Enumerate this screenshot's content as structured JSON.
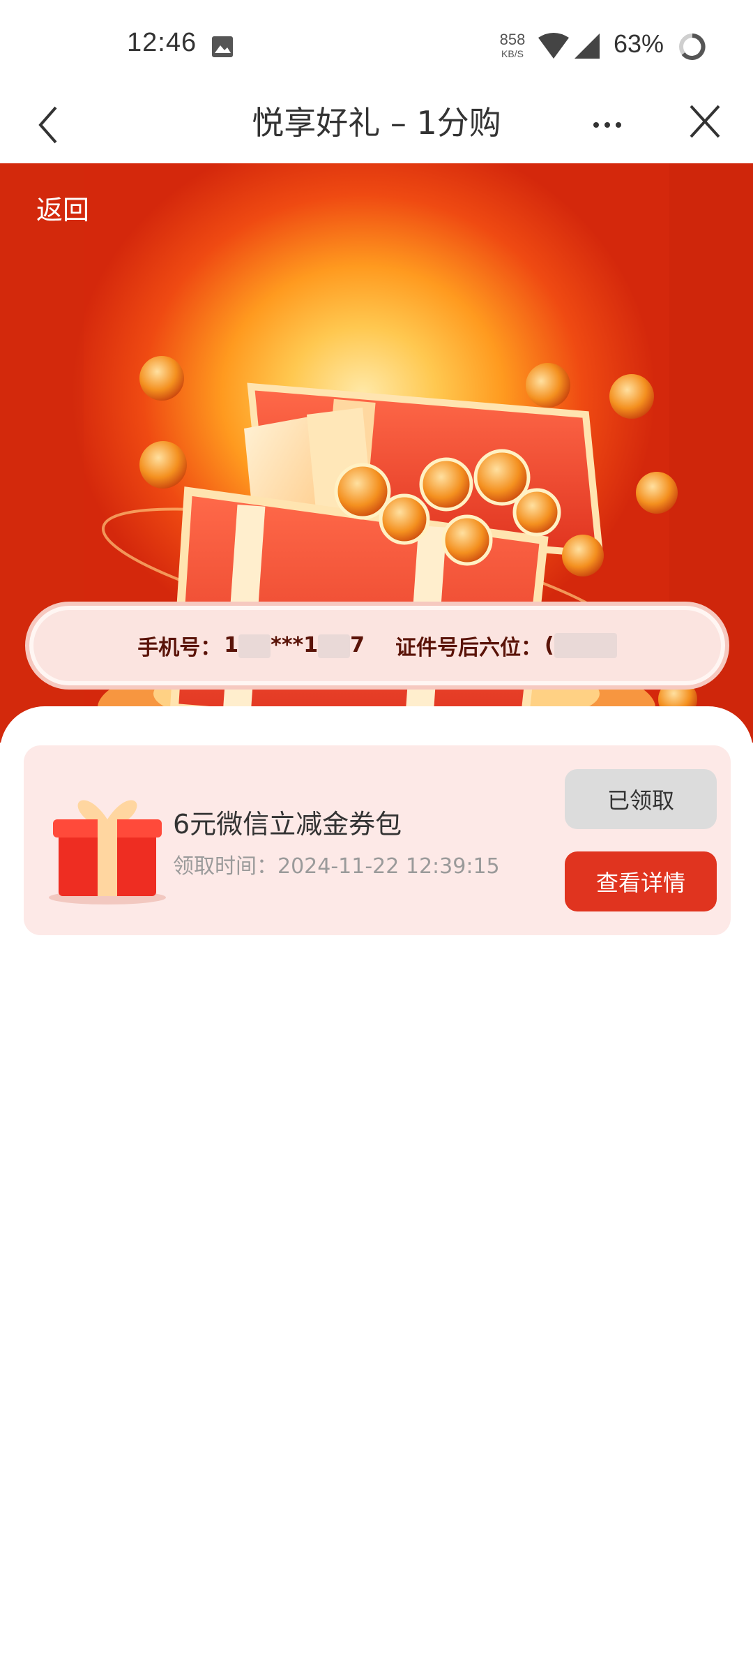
{
  "status_bar": {
    "time": "12:46",
    "net_speed_value": "858",
    "net_speed_unit": "KB/S",
    "battery": "63%",
    "gallery_icon": "image-icon",
    "wifi_icon": "wifi-icon",
    "signal_icon": "cell-signal-icon",
    "battery_icon": "battery-ring-icon"
  },
  "title_bar": {
    "title": "悦享好礼 – 1分购",
    "back_icon": "chevron-left-icon",
    "more_icon": "more-dots-icon",
    "close_icon": "close-icon"
  },
  "banner": {
    "back_label": "返回",
    "phone_label": "手机号：",
    "phone_value_visible": "1",
    "phone_value_mid": "***1",
    "phone_value_end": "7",
    "id_label": "证件号后六位：",
    "id_value_visible": "("
  },
  "reward": {
    "title": "6元微信立减金券包",
    "time_label": "领取时间：",
    "time_value": "2024-11-22 12:39:15",
    "claimed_label": "已领取",
    "details_label": "查看详情",
    "gift_icon": "gift-box-icon"
  },
  "colors": {
    "banner_red": "#d4280c",
    "banner_glow": "#ffc850",
    "card_bg": "#fde9e7",
    "primary_button": "#e0341f",
    "disabled_button": "#dcdcdc"
  }
}
